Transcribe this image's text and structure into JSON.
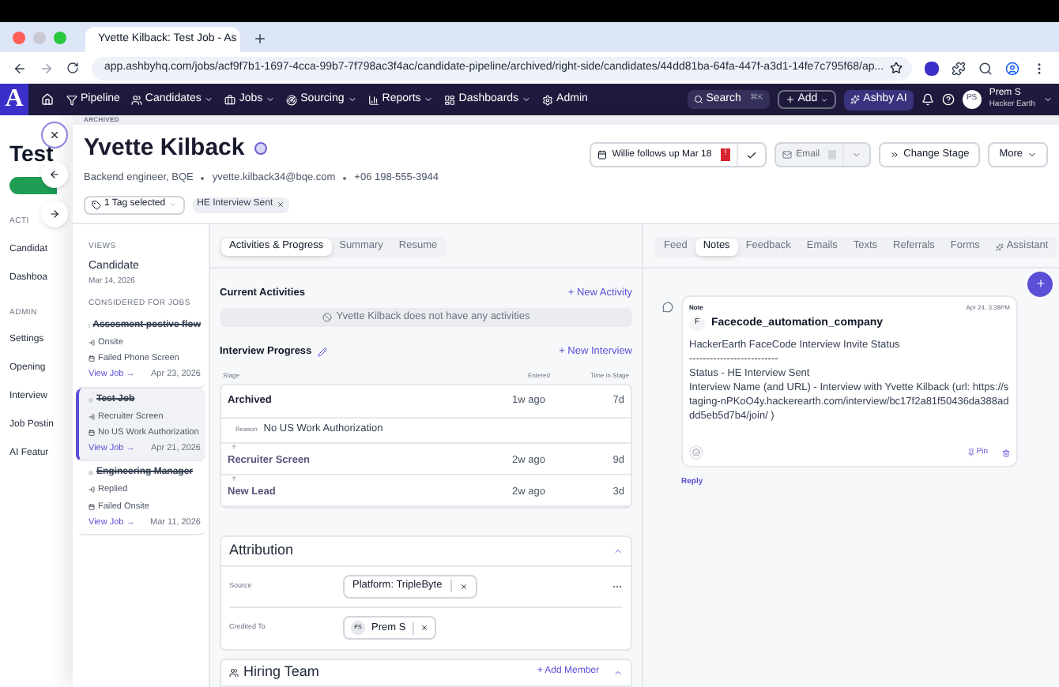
{
  "browser": {
    "tab_title": "Yvette Kilback: Test Job - As",
    "url": "app.ashbyhq.com/jobs/acf9f7b1-1697-4cca-99b7-7f798ac3f4ac/candidate-pipeline/archived/right-side/candidates/44dd81ba-64fa-447f-a3d1-14fe7c795f68/ap..."
  },
  "nav": {
    "logo": "A",
    "items": [
      {
        "label": "Pipeline",
        "dropdown": false
      },
      {
        "label": "Candidates",
        "dropdown": true
      },
      {
        "label": "Jobs",
        "dropdown": true
      },
      {
        "label": "Sourcing",
        "dropdown": true
      },
      {
        "label": "Reports",
        "dropdown": true
      },
      {
        "label": "Dashboards",
        "dropdown": true
      },
      {
        "label": "Admin",
        "dropdown": false
      }
    ],
    "search": "Search",
    "shortcut": "⌘K",
    "add": "Add",
    "ai": "Ashby AI",
    "user": {
      "initials": "PS",
      "name": "Prem S",
      "org": "Hacker Earth"
    }
  },
  "background_page": {
    "title": "Test",
    "sections": [
      {
        "heading": "ACTI",
        "items": [
          "Candidat",
          "Dashboa"
        ]
      },
      {
        "heading": "ADMIN",
        "items": [
          "Settings",
          "Opening",
          "Interview",
          "Job Postin",
          "AI Featur"
        ]
      }
    ]
  },
  "drawer": {
    "status": "ARCHIVED",
    "name": "Yvette Kilback",
    "role": "Backend engineer, BQE",
    "email": "yvette.kilback34@bqe.com",
    "phone": "+06 198-555-3944",
    "followup": "Willie follows up Mar 18",
    "followup_badge": "!",
    "email_button": "Email",
    "change_stage": "Change Stage",
    "more": "More",
    "tag_select": "1 Tag selected",
    "tags": [
      "HE Interview Sent"
    ]
  },
  "views": {
    "heading": "VIEWS",
    "view": {
      "name": "Candidate",
      "date": "Mar 14, 2026"
    },
    "jobs_heading": "CONSIDERED FOR JOBS",
    "jobs": [
      {
        "name": "Assesment postive flow",
        "stage": "Onsite",
        "status": "Failed Phone Screen",
        "link": "View Job →",
        "date": "Apr 23, 2026",
        "selected": false
      },
      {
        "name": "Test Job",
        "stage": "Recruiter Screen",
        "status": "No US Work Authorization",
        "link": "View Job →",
        "date": "Apr 21, 2026",
        "selected": true
      },
      {
        "name": "Engineering Manager",
        "stage": "Replied",
        "status": "Failed Onsite",
        "link": "View Job →",
        "date": "Mar 11, 2026",
        "selected": false
      }
    ]
  },
  "main": {
    "tabs": [
      {
        "label": "Activities & Progress",
        "selected": true
      },
      {
        "label": "Summary",
        "selected": false
      },
      {
        "label": "Resume",
        "selected": false
      }
    ],
    "current_activities": "Current Activities",
    "new_activity": "+ New Activity",
    "no_activities": "Yvette Kilback does not have any activities",
    "interview_progress": "Interview Progress",
    "new_interview": "+ New Interview",
    "columns": [
      "Stage",
      "Entered",
      "Time in Stage"
    ],
    "stages": [
      {
        "kind": "current",
        "name": "Archived",
        "entered": "1w ago",
        "time": "7d",
        "reason_label": "Reason",
        "reason": "No US Work Authorization"
      },
      {
        "kind": "past",
        "name": "Recruiter Screen",
        "entered": "2w ago",
        "time": "9d"
      },
      {
        "kind": "past",
        "name": "New Lead",
        "entered": "2w ago",
        "time": "3d"
      }
    ],
    "attribution": {
      "title": "Attribution",
      "expanded": true,
      "source_label": "Source",
      "source": "Platform: TripleByte",
      "credited_label": "Credited To",
      "credited_initials": "PS",
      "credited": "Prem S"
    },
    "hiring_team": {
      "title": "Hiring Team",
      "add": "+ Add Member",
      "expanded": true
    }
  },
  "side": {
    "tabs": [
      {
        "label": "Feed",
        "selected": false
      },
      {
        "label": "Notes",
        "selected": true
      },
      {
        "label": "Feedback",
        "selected": false
      },
      {
        "label": "Emails",
        "selected": false
      },
      {
        "label": "Texts",
        "selected": false
      },
      {
        "label": "Referrals",
        "selected": false
      },
      {
        "label": "Forms",
        "selected": false
      },
      {
        "label": "Assistant",
        "selected": false
      }
    ],
    "note": {
      "type": "Note",
      "time": "Apr 24, 3:38PM",
      "author_initial": "F",
      "author": "Facecode_automation_company",
      "lines": [
        "HackerEarth FaceCode Interview Invite Status",
        "--------------------------",
        "Status - HE Interview Sent",
        "Interview Name (and URL) - Interview with Yvette Kilback (url: https://staging-nPKoO4y.hackerearth.com/interview/bc17f2a81f50436da388addd5eb5d7b4/join/ )"
      ],
      "pin": "Pin",
      "reply": "Reply"
    }
  }
}
